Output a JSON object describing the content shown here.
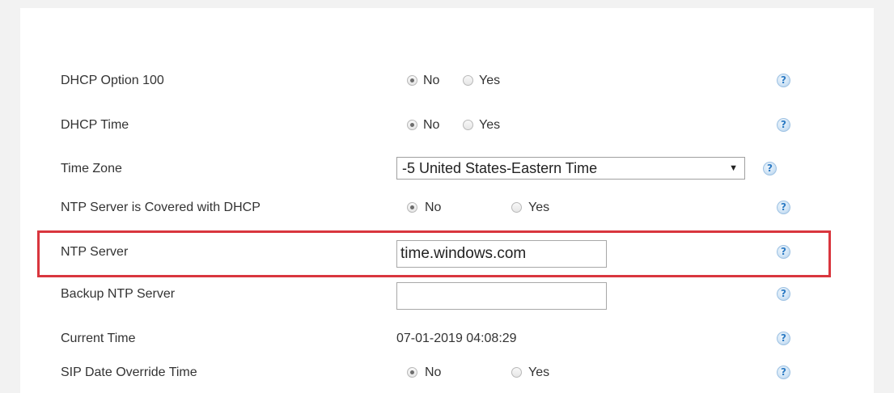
{
  "settings": {
    "dhcp_option_100": {
      "label": "DHCP Option 100",
      "options": [
        "No",
        "Yes"
      ],
      "selected": "No"
    },
    "dhcp_time": {
      "label": "DHCP Time",
      "options": [
        "No",
        "Yes"
      ],
      "selected": "No"
    },
    "time_zone": {
      "label": "Time Zone",
      "value": "-5 United States-Eastern Time",
      "arrow": "▼"
    },
    "ntp_covered_dhcp": {
      "label": "NTP Server is Covered with DHCP",
      "options": [
        "No",
        "Yes"
      ],
      "selected": "No"
    },
    "ntp_server": {
      "label": "NTP Server",
      "value": "time.windows.com"
    },
    "backup_ntp_server": {
      "label": "Backup NTP Server",
      "value": ""
    },
    "current_time": {
      "label": "Current Time",
      "value": "07-01-2019 04:08:29"
    },
    "sip_date_override": {
      "label": "SIP Date Override Time",
      "options": [
        "No",
        "Yes"
      ],
      "selected": "No"
    }
  },
  "help_icon_glyph": "?",
  "colors": {
    "highlight_border": "#d9363e",
    "help_icon": "#2d7bc4",
    "background": "#f2f2f2",
    "panel": "#ffffff"
  }
}
